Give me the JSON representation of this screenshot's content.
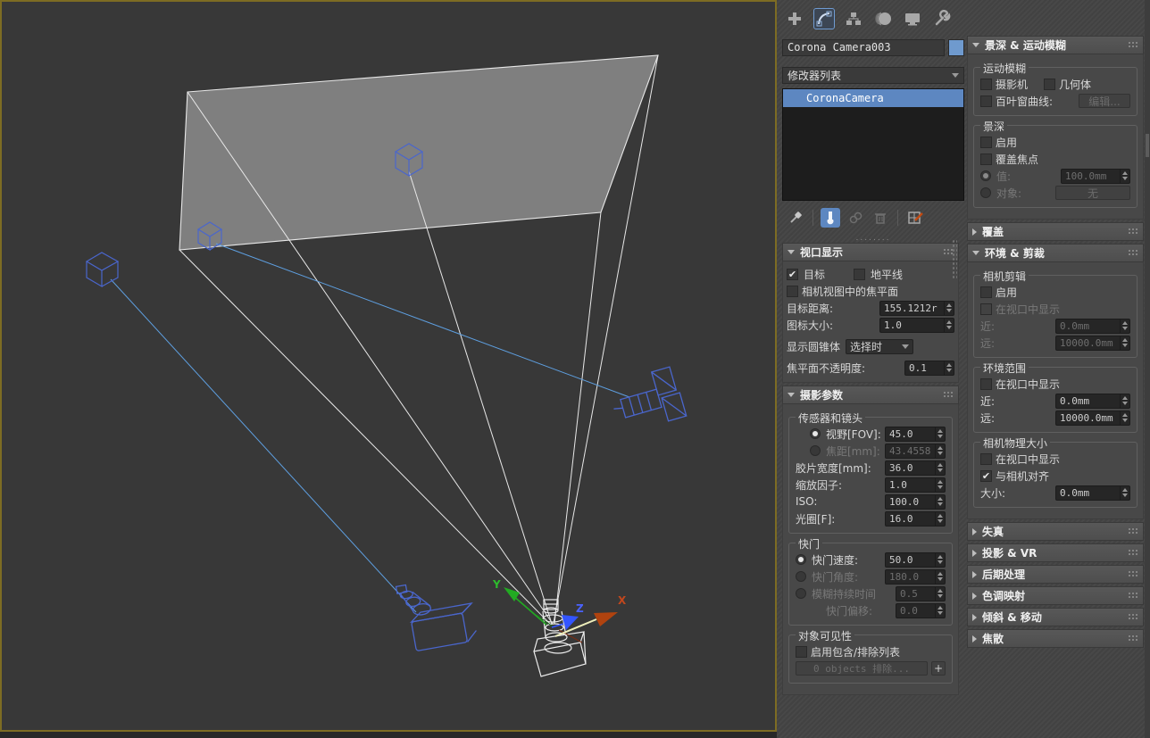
{
  "viewport": {
    "axis_x": "X",
    "axis_y": "Y",
    "axis_z": "Z",
    "colors": {
      "background": "#383838",
      "active_border": "#7d6c23",
      "selected_wireframe": "#e8e8e8",
      "camera_wireframe": "#4a66cc",
      "target_line": "#5e9fe0",
      "frustum_plane": "#7f7f7f",
      "axis_x_color": "#c1471d",
      "axis_y_color": "#22aa22",
      "axis_z_color": "#3355ff"
    }
  },
  "panel": {
    "colors": {
      "selection_blue": "#5d87c1",
      "wire_swatch": "#6f9ace"
    },
    "tabs": [
      {
        "name": "create"
      },
      {
        "name": "modify"
      },
      {
        "name": "hierarchy"
      },
      {
        "name": "motion"
      },
      {
        "name": "display"
      },
      {
        "name": "utilities"
      }
    ],
    "name_field": {
      "value": "Corona Camera003"
    },
    "modifier_list": {
      "label": "修改器列表"
    },
    "stack": {
      "items": [
        {
          "label": "CoronaCamera"
        }
      ]
    },
    "separator_dots": "........",
    "left": {
      "viewport_display": {
        "title": "视口显示",
        "cb_target": "目标",
        "cb_horizon": "地平线",
        "cb_focus_plane": "相机视图中的焦平面",
        "target_distance_label": "目标距离:",
        "target_distance_value": "155.1212r",
        "icon_size_label": "图标大小:",
        "icon_size_value": "1.0",
        "show_cone_label": "显示圆锥体",
        "show_cone_value": "选择时",
        "focus_opacity_label": "焦平面不透明度:",
        "focus_opacity_value": "0.1"
      },
      "photo_params": {
        "title": "摄影参数",
        "group_sensor": "传感器和镜头",
        "fov_label": "视野[FOV]:",
        "fov_value": "45.0",
        "focal_label": "焦距[mm]:",
        "focal_value": "43.4558",
        "film_label": "胶片宽度[mm]:",
        "film_value": "36.0",
        "zoom_label": "缩放因子:",
        "zoom_value": "1.0",
        "iso_label": "ISO:",
        "iso_value": "100.0",
        "fstop_label": "光圈[F]:",
        "fstop_value": "16.0",
        "group_shutter": "快门",
        "shutter_speed_label": "快门速度:",
        "shutter_speed_value": "50.0",
        "shutter_angle_label": "快门角度:",
        "shutter_angle_value": "180.0",
        "blur_duration_label": "模糊持续时间",
        "blur_duration_value": "0.5",
        "shutter_offset_label": "快门偏移:",
        "shutter_offset_value": "0.0",
        "group_visibility": "对象可见性",
        "cb_include_exclude": "启用包含/排除列表",
        "exclude_button": "0 objects 排除...",
        "plus_button": "+"
      }
    },
    "right": {
      "dof_mb": {
        "title": "景深 & 运动模糊",
        "group_mb": "运动模糊",
        "cb_camera": "摄影机",
        "cb_geometry": "几何体",
        "cb_shutter_curve": "百叶窗曲线:",
        "edit_button": "编辑...",
        "group_dof": "景深",
        "cb_enable": "启用",
        "cb_override_focus": "覆盖焦点",
        "value_label": "值:",
        "value_value": "100.0mm",
        "object_label": "对象:",
        "none_button": "无"
      },
      "override": {
        "title": "覆盖"
      },
      "env_clip": {
        "title": "环境 & 剪裁",
        "group_clip": "相机剪辑",
        "cb_enable": "启用",
        "cb_show_viewport": "在视口中显示",
        "near_label": "近:",
        "near_value": "0.0mm",
        "far_label": "远:",
        "far_value": "10000.0mm",
        "group_env": "环境范围",
        "cb_show_viewport2": "在视口中显示",
        "near2_label": "近:",
        "near2_value": "0.0mm",
        "far2_label": "远:",
        "far2_value": "10000.0mm",
        "group_size": "相机物理大小",
        "cb_show_viewport3": "在视口中显示",
        "cb_align": "与相机对齐",
        "size_label": "大小:",
        "size_value": "0.0mm"
      },
      "collapsed": [
        {
          "title": "失真"
        },
        {
          "title": "投影 & VR"
        },
        {
          "title": "后期处理"
        },
        {
          "title": "色调映射"
        },
        {
          "title": "倾斜 & 移动"
        },
        {
          "title": "焦散"
        }
      ]
    }
  }
}
